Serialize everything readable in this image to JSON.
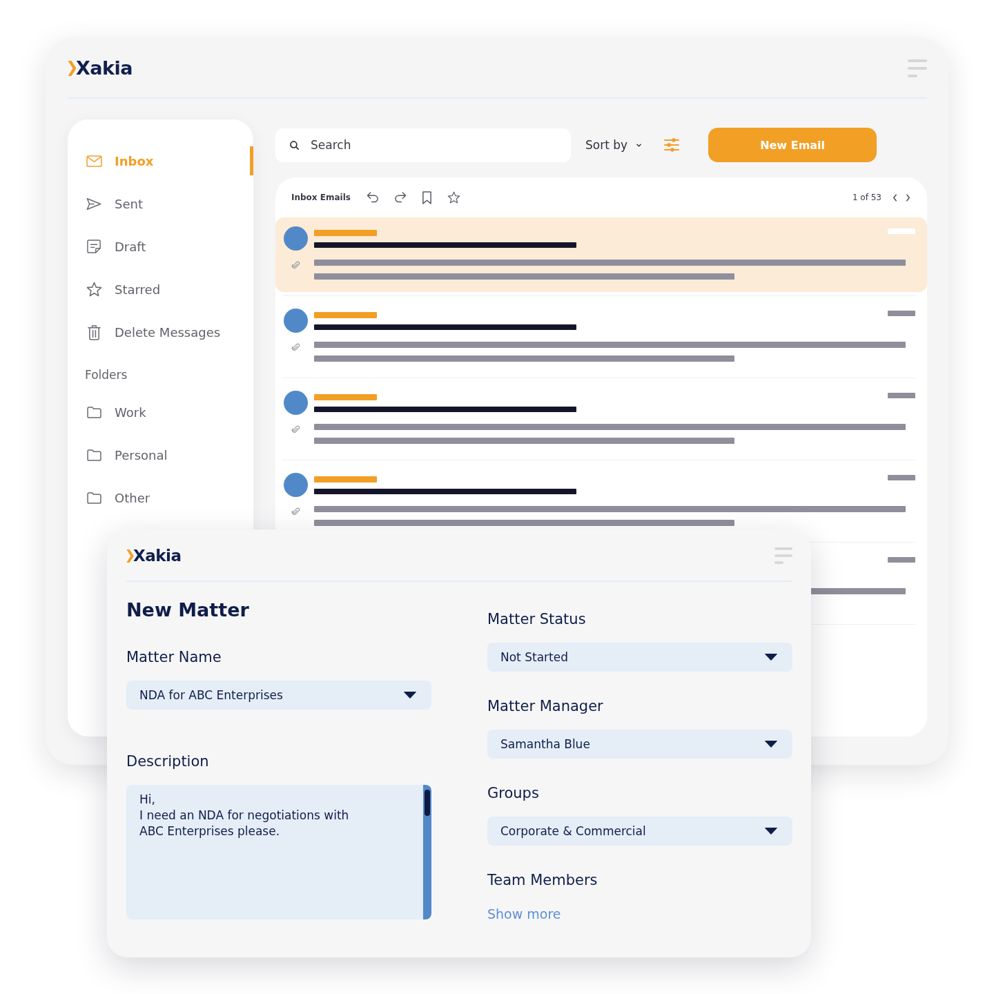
{
  "window": {
    "logo": "Xakia"
  },
  "sidebar": {
    "items": [
      {
        "label": "Inbox",
        "selected": true
      },
      {
        "label": "Sent",
        "selected": false
      },
      {
        "label": "Draft",
        "selected": false
      },
      {
        "label": "Starred",
        "selected": false
      },
      {
        "label": "Delete Messages",
        "selected": false
      }
    ],
    "folders_heading": "Folders",
    "folders": [
      {
        "label": "Work",
        "selected": false
      },
      {
        "label": "Personal",
        "selected": false
      },
      {
        "label": "Other",
        "selected": false
      }
    ]
  },
  "toolbar": {
    "search": {
      "placeholder": "Search"
    },
    "sort": "Sort by",
    "new_email": "New Email"
  },
  "inbox": {
    "title": "Inbox Emails",
    "pagination": "1 of 53",
    "emails": [
      {
        "selected": true,
        "attachment": true
      },
      {
        "selected": false,
        "attachment": true
      },
      {
        "selected": false,
        "attachment": true
      },
      {
        "selected": false,
        "attachment": true
      },
      {
        "selected": false
      }
    ]
  },
  "new_matter": {
    "logo": "Xakia",
    "title": "New Matter",
    "left_fields": [
      {
        "kind": "dropdown",
        "label": "Matter Name",
        "value": "NDA for ABC Enterprises"
      },
      {
        "kind": "textarea",
        "label": "Description",
        "value": "Hi,\nI need an NDA for negotiations with\nABC Enterprises please."
      }
    ],
    "right_fields": [
      {
        "kind": "dropdown",
        "label": "Matter Status",
        "value": "Not Started"
      },
      {
        "kind": "dropdown",
        "label": "Matter Manager",
        "value": "Samantha Blue"
      },
      {
        "kind": "dropdown",
        "label": "Groups",
        "value": "Corporate & Commercial"
      },
      {
        "kind": "link",
        "label": "Team Members",
        "link": "Show more"
      }
    ]
  }
}
